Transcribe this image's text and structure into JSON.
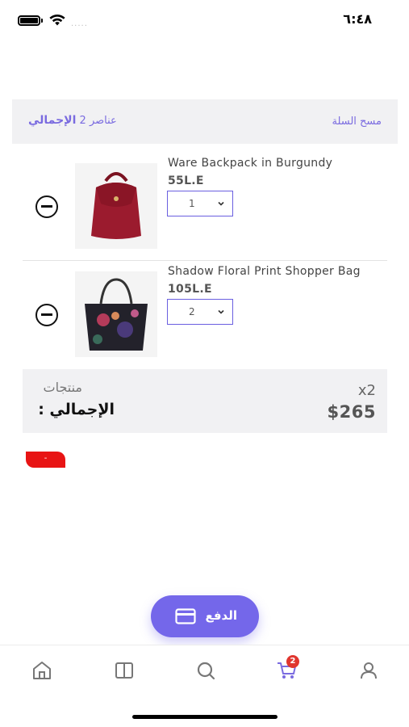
{
  "status_bar": {
    "time": "٦:٤٨",
    "signal": "....."
  },
  "cart_header": {
    "clear_cart_label": "مسح السلة",
    "items_count_text": "عناصر 2",
    "total_word": "الإجمالي"
  },
  "items": [
    {
      "name": "Ware Backpack in Burgundy",
      "price": "55L.E",
      "quantity": "1"
    },
    {
      "name": "Shadow Floral Print Shopper Bag",
      "price": "105L.E",
      "quantity": "2"
    }
  ],
  "summary": {
    "products_label": "منتجات",
    "total_label": "الإجمالي :",
    "quantity": "x2",
    "total_amount": "$265"
  },
  "promo_badge": "-",
  "checkout": {
    "label": "الدفع"
  },
  "bottom_nav": {
    "cart_count": "2",
    "active_tab": "cart",
    "active_color": "#7a6be0",
    "inactive_color": "#777777"
  },
  "colors": {
    "accent": "#7467ea",
    "badge_red": "#e81414",
    "header_bg": "#f1f1f3"
  }
}
